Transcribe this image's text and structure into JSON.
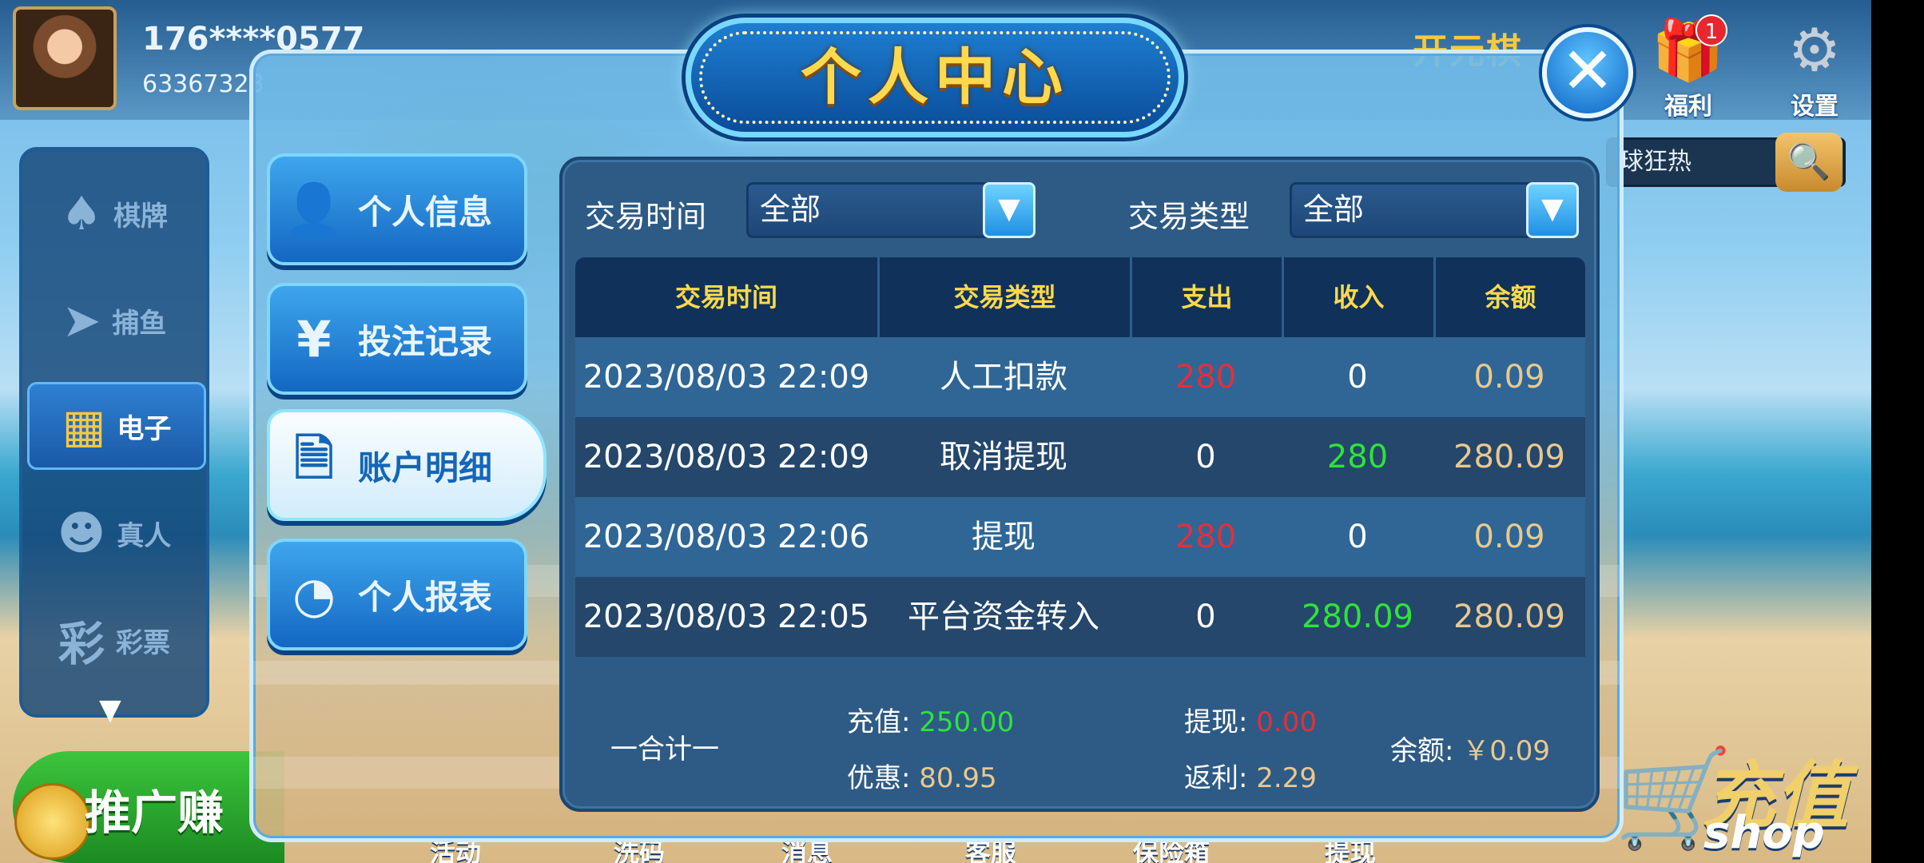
{
  "player": {
    "name": "176****0577",
    "id": "63367323"
  },
  "brand": {
    "text": "开元棋"
  },
  "top_buttons": {
    "gift": {
      "label": "福利",
      "badge": "1",
      "icon": "gift-icon"
    },
    "settings": {
      "label": "设置",
      "icon": "gear-icon"
    }
  },
  "search": {
    "value": "球狂热"
  },
  "categories": [
    {
      "label": "棋牌",
      "icon": "spade-card-icon",
      "glyph": "♠"
    },
    {
      "label": "捕鱼",
      "icon": "fish-icon",
      "glyph": "🐟"
    },
    {
      "label": "电子",
      "icon": "slot-machine-icon",
      "glyph": "▦",
      "active": true
    },
    {
      "label": "真人",
      "icon": "dealer-icon",
      "glyph": "👤"
    },
    {
      "label": "彩票",
      "icon": "lottery-icon",
      "glyph": "彩"
    }
  ],
  "promo": {
    "label": "推广赚"
  },
  "shop": {
    "label": "充值",
    "sub": "shop"
  },
  "bottom_nav": [
    "活动",
    "洗码",
    "消息",
    "客服",
    "保险箱",
    "提现"
  ],
  "modal": {
    "title": "个人中心",
    "menu": [
      {
        "label": "个人信息",
        "icon": "user-icon",
        "glyph": "👤"
      },
      {
        "label": "投注记录",
        "icon": "banknote-icon",
        "glyph": "¥"
      },
      {
        "label": "账户明细",
        "icon": "document-search-icon",
        "glyph": "🗎",
        "active": true
      },
      {
        "label": "个人报表",
        "icon": "pie-chart-icon",
        "glyph": "◔"
      }
    ],
    "filters": {
      "time_label": "交易时间",
      "time_value": "全部",
      "type_label": "交易类型",
      "type_value": "全部"
    },
    "table": {
      "headers": [
        "交易时间",
        "交易类型",
        "支出",
        "收入",
        "余额"
      ],
      "rows": [
        {
          "time": "2023/08/03 22:09",
          "type": "人工扣款",
          "out": "280",
          "in": "0",
          "balance": "0.09"
        },
        {
          "time": "2023/08/03 22:09",
          "type": "取消提现",
          "out": "0",
          "in": "280",
          "balance": "280.09"
        },
        {
          "time": "2023/08/03 22:06",
          "type": "提现",
          "out": "280",
          "in": "0",
          "balance": "0.09"
        },
        {
          "time": "2023/08/03 22:05",
          "type": "平台资金转入",
          "out": "0",
          "in": "280.09",
          "balance": "280.09"
        }
      ]
    },
    "summary": {
      "total_label": "一合计一",
      "recharge_label": "充值:",
      "recharge_value": "250.00",
      "bonus_label": "优惠:",
      "bonus_value": "80.95",
      "withdraw_label": "提现:",
      "withdraw_value": "0.00",
      "rebate_label": "返利:",
      "rebate_value": "2.29",
      "balance_label": "余额:",
      "balance_value": "￥0.09"
    }
  },
  "colors": {
    "expense": "#e1303c",
    "income": "#2ee33a",
    "balance": "#e9c88e",
    "header_text": "#ffd94a"
  }
}
